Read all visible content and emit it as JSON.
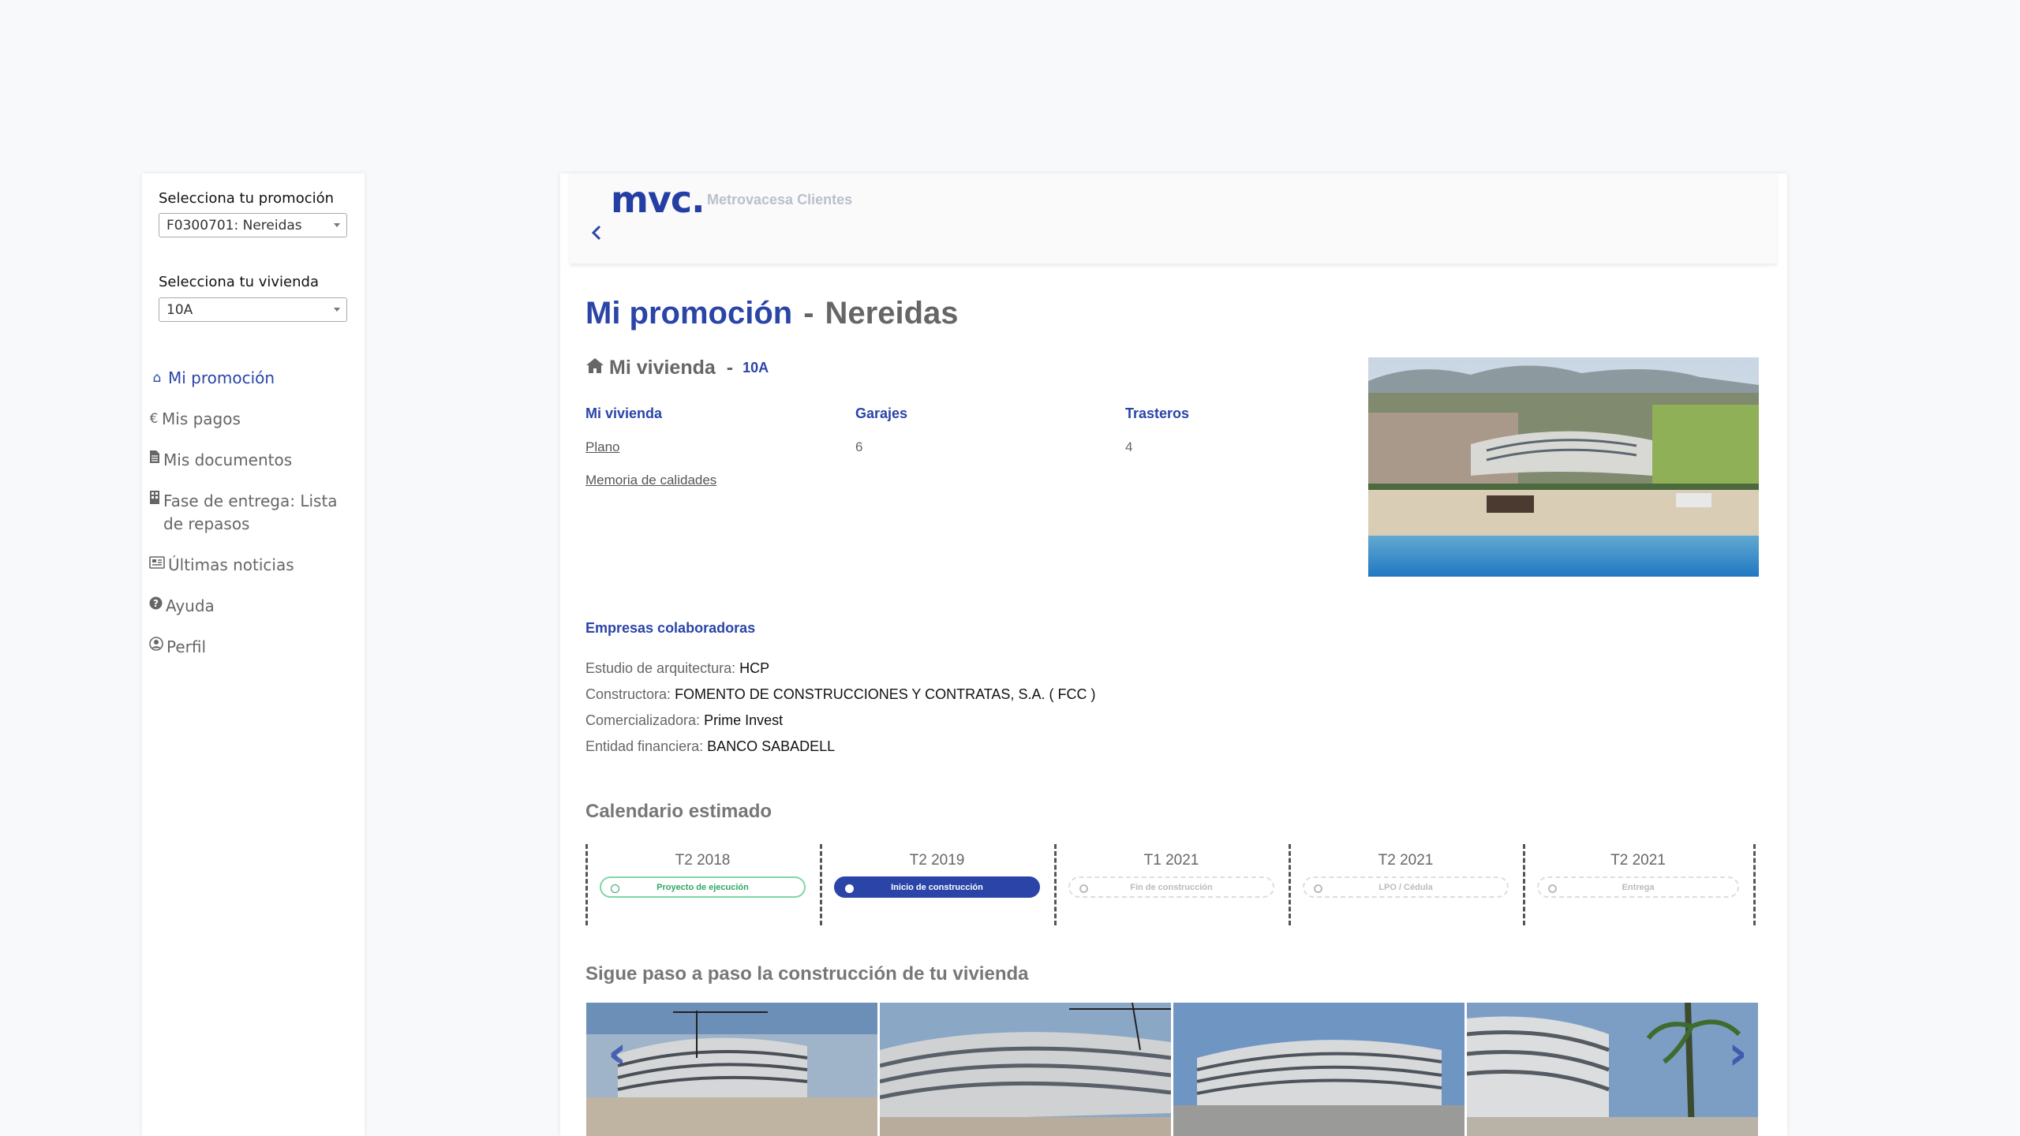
{
  "sidebar": {
    "promotion_label": "Selecciona tu promoción",
    "promotion_value": "F0300701: Nereidas",
    "unit_label": "Selecciona tu vivienda",
    "unit_value": "10A",
    "nav": [
      {
        "label": "Mi promoción",
        "icon": "home-icon",
        "active": true
      },
      {
        "label": "Mis pagos",
        "icon": "euro-icon"
      },
      {
        "label": "Mis documentos",
        "icon": "document-icon"
      },
      {
        "label": "Fase de entrega: Lista de repasos",
        "icon": "building-icon"
      },
      {
        "label": "Últimas noticias",
        "icon": "newspaper-icon"
      },
      {
        "label": "Ayuda",
        "icon": "question-icon"
      },
      {
        "label": "Perfil",
        "icon": "user-icon"
      }
    ]
  },
  "header": {
    "logo": "mvc.",
    "brand": "Metrovacesa Clientes"
  },
  "page": {
    "title": "Mi promoción",
    "promotion": "Nereidas",
    "dash": "-"
  },
  "vivienda": {
    "title": "Mi vivienda",
    "unit": "10A",
    "col1_header": "Mi vivienda",
    "col2_header": "Garajes",
    "col3_header": "Trasteros",
    "plano": "Plano",
    "memoria": "Memoria de calidades",
    "garajes": "6",
    "trasteros": "4"
  },
  "empresas": {
    "title": "Empresas colaboradoras",
    "rows": [
      {
        "label": "Estudio de arquitectura:",
        "value": "HCP"
      },
      {
        "label": "Constructora:",
        "value": "FOMENTO DE CONSTRUCCIONES Y CONTRATAS, S.A. ( FCC )"
      },
      {
        "label": "Comercializadora:",
        "value": "Prime Invest"
      },
      {
        "label": "Entidad financiera:",
        "value": "BANCO SABADELL"
      }
    ]
  },
  "calendar": {
    "title": "Calendario estimado",
    "steps": [
      {
        "date": "T2 2018",
        "label": "Proyecto de ejecución",
        "status": "done"
      },
      {
        "date": "T2 2019",
        "label": "Inicio de construcción",
        "status": "current"
      },
      {
        "date": "T1 2021",
        "label": "Fin de construcción",
        "status": "future"
      },
      {
        "date": "T2 2021",
        "label": "LPO / Cédula",
        "status": "future"
      },
      {
        "date": "T2 2021",
        "label": "Entrega",
        "status": "future"
      }
    ]
  },
  "gallery": {
    "title": "Sigue paso a paso la construcción de tu vivienda",
    "prev": "‹",
    "next": "›"
  },
  "colors": {
    "accent": "#2a44a8",
    "done": "#2fa864"
  }
}
